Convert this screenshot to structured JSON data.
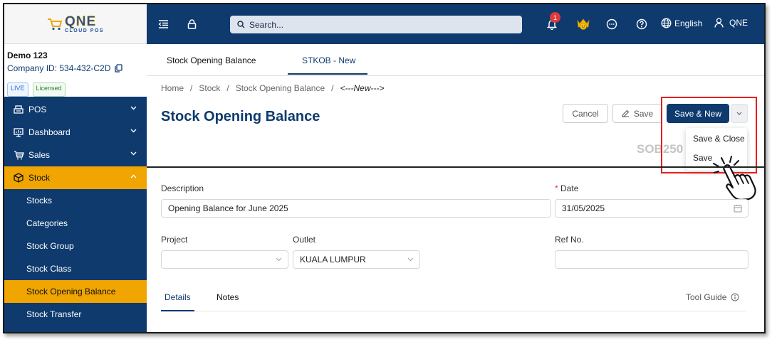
{
  "logo": {
    "main": "QNE",
    "sub": "CLOUD POS"
  },
  "company": {
    "name": "Demo 123",
    "id": "Company ID: 534-432-C2D",
    "badge_live": "LIVE",
    "badge_licensed": "Licensed"
  },
  "sidebar": {
    "menu": [
      {
        "label": "POS",
        "icon": "printer-icon"
      },
      {
        "label": "Dashboard",
        "icon": "monitor-icon"
      },
      {
        "label": "Sales",
        "icon": "cart-icon"
      },
      {
        "label": "Stock",
        "icon": "box-icon"
      }
    ],
    "stock_items": [
      "Stocks",
      "Categories",
      "Stock Group",
      "Stock Class",
      "Stock Opening Balance",
      "Stock Transfer"
    ]
  },
  "topbar": {
    "search_placeholder": "Search...",
    "notification_count": "1",
    "language": "English",
    "user": "QNE"
  },
  "tabs": {
    "list_tab": "Stock Opening Balance",
    "active_tab": "STKOB - New"
  },
  "breadcrumb": {
    "home": "Home",
    "stock": "Stock",
    "page": "Stock Opening Balance",
    "current": "<---New--->",
    "sep": "/"
  },
  "page": {
    "title": "Stock Opening Balance",
    "doc_no": "SOB250"
  },
  "buttons": {
    "cancel": "Cancel",
    "save": "Save",
    "save_new": "Save & New"
  },
  "dropdown": {
    "save_close": "Save & Close",
    "save": "Save"
  },
  "form": {
    "description_label": "Description",
    "description_value": "Opening Balance for June 2025",
    "date_required": "*",
    "date_label": "Date",
    "date_value": "31/05/2025",
    "project_label": "Project",
    "project_value": "",
    "outlet_label": "Outlet",
    "outlet_value": "KUALA LUMPUR",
    "refno_label": "Ref No.",
    "refno_value": ""
  },
  "detail_tabs": {
    "details": "Details",
    "notes": "Notes",
    "tool_guide": "Tool Guide"
  },
  "colors": {
    "navy": "#0e3a6e",
    "accent": "#f0a500",
    "highlight": "#e41f1f"
  }
}
